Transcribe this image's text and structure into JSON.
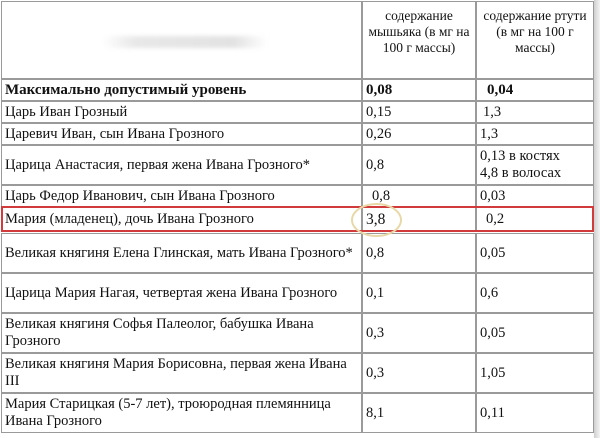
{
  "header": {
    "arsenic": "содержание мышьяка (в мг на 100 г массы)",
    "mercury": "содержание ртути (в мг на 100 г массы)"
  },
  "rows": [
    {
      "name": "Максимально допустимый уровень",
      "arsenic": "0,08",
      "mercury": "0,04"
    },
    {
      "name": "Царь Иван Грозный",
      "arsenic": "0,15",
      "mercury": "1,3"
    },
    {
      "name": "Царевич Иван, сын Ивана Грозного",
      "arsenic": "0,26",
      "mercury": "1,3"
    },
    {
      "name": "Царица Анастасия, первая жена Ивана Грозного*",
      "arsenic": "0,8",
      "mercury": "0,13 в костях\n4,8 в волосах"
    },
    {
      "name": "Царь Федор Иванович, сын Ивана Грозного",
      "arsenic": "0,8",
      "mercury": "0,03"
    },
    {
      "name": "Мария (младенец), дочь Ивана Грозного",
      "arsenic": "3,8",
      "mercury": "0,2"
    },
    {
      "name": "Великая княгиня Елена Глинская, мать Ивана Грозного*",
      "arsenic": "0,8",
      "mercury": "0,05"
    },
    {
      "name": "Царица Мария Нагая, четвертая жена Ивана Грозного",
      "arsenic": "0,1",
      "mercury": "0,6"
    },
    {
      "name": "Великая княгиня Софья Палеолог, бабушка Ивана Грозного",
      "arsenic": "0,3",
      "mercury": "0,05"
    },
    {
      "name": "Великая княгиня Мария Борисовна, первая жена Ивана III",
      "arsenic": "0,3",
      "mercury": "1,05"
    },
    {
      "name": "Мария Старицкая (5-7 лет), троюродная племянница Ивана Грозного",
      "arsenic": "8,1",
      "mercury": "0,11"
    }
  ],
  "colors": {
    "highlight_border": "#d23b3b",
    "oval_border": "#e8d8a8",
    "grid": "#9a9a9a"
  }
}
